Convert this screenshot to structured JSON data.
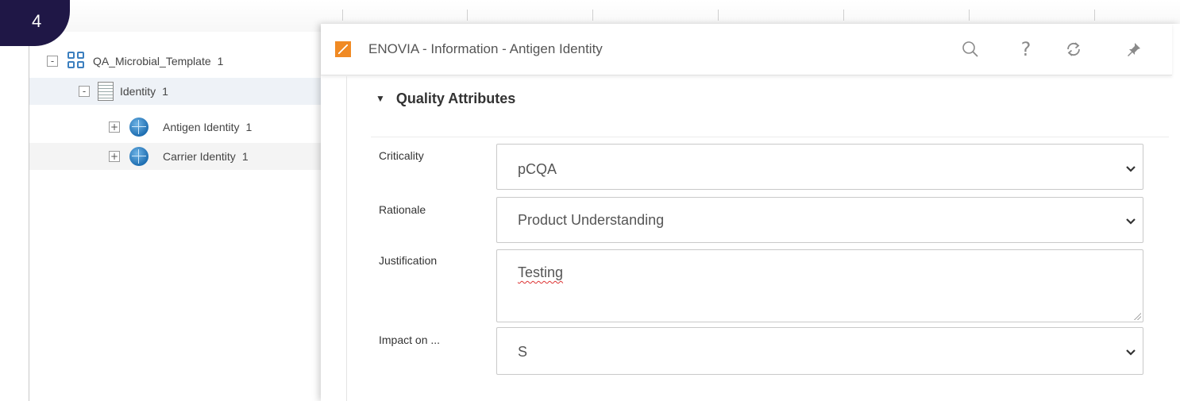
{
  "badge": {
    "step": "4"
  },
  "tree": {
    "root": {
      "label": "QA_Microbial_Template",
      "rev": "1",
      "toggle": "-"
    },
    "items": [
      {
        "label": "Identity",
        "rev": "1",
        "toggle": "-"
      },
      {
        "label": "Antigen Identity",
        "rev": "1",
        "toggle": "+"
      },
      {
        "label": "Carrier Identity",
        "rev": "1",
        "toggle": "+"
      }
    ]
  },
  "panel": {
    "title": "ENOVIA - Information - Antigen Identity",
    "icons": {
      "search": "search-icon",
      "help": "help-icon",
      "refresh": "refresh-icon",
      "pin": "pin-icon"
    },
    "help_glyph": "?",
    "section": {
      "label": "Quality Attributes",
      "toggle": "▼"
    },
    "fields": {
      "criticality": {
        "label": "Criticality",
        "value": "pCQA"
      },
      "rationale": {
        "label": "Rationale",
        "value": "Product Understanding"
      },
      "justification": {
        "label": "Justification",
        "value": "Testing"
      },
      "impact": {
        "label": "Impact on ...",
        "value": "S"
      }
    }
  },
  "colors": {
    "badge": "#1f1746",
    "accent": "#f08a24",
    "tree_icon": "#3b7fbf"
  }
}
